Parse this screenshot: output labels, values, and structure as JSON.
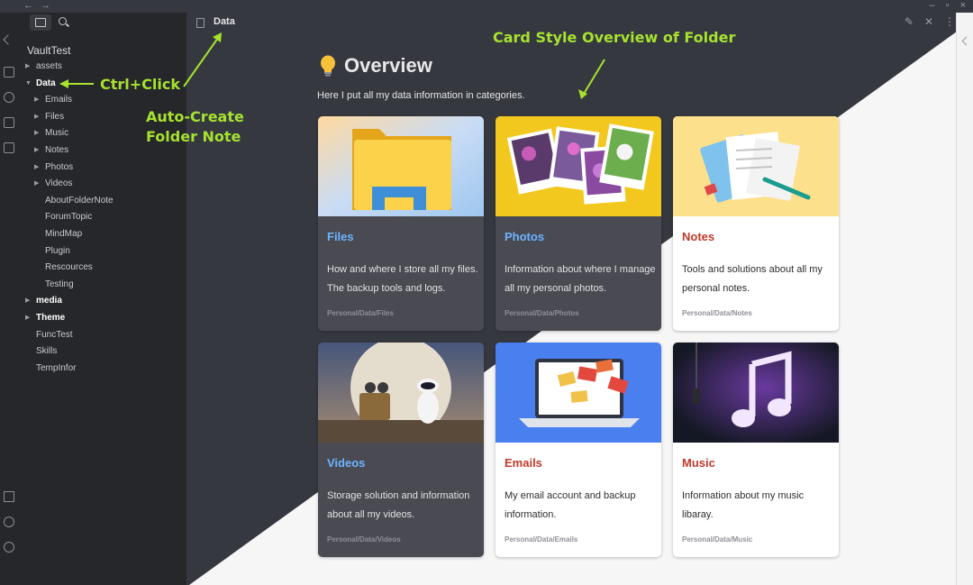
{
  "editor": {
    "doc_title": "Data"
  },
  "sidebar": {
    "vault": "VaultTest",
    "tree": [
      {
        "label": "assets",
        "level": 0,
        "arrow": "right",
        "bold": false
      },
      {
        "label": "Data",
        "level": 0,
        "arrow": "down",
        "bold": true
      },
      {
        "label": "Emails",
        "level": 1,
        "arrow": "right",
        "bold": false
      },
      {
        "label": "Files",
        "level": 1,
        "arrow": "right",
        "bold": false
      },
      {
        "label": "Music",
        "level": 1,
        "arrow": "right",
        "bold": false
      },
      {
        "label": "Notes",
        "level": 1,
        "arrow": "right",
        "bold": false
      },
      {
        "label": "Photos",
        "level": 1,
        "arrow": "right",
        "bold": false
      },
      {
        "label": "Videos",
        "level": 1,
        "arrow": "right",
        "bold": false
      },
      {
        "label": "AboutFolderNote",
        "level": 1,
        "arrow": "",
        "bold": false
      },
      {
        "label": "ForumTopic",
        "level": 1,
        "arrow": "",
        "bold": false
      },
      {
        "label": "MindMap",
        "level": 1,
        "arrow": "",
        "bold": false
      },
      {
        "label": "Plugin",
        "level": 1,
        "arrow": "",
        "bold": false
      },
      {
        "label": "Rescources",
        "level": 1,
        "arrow": "",
        "bold": false
      },
      {
        "label": "Testing",
        "level": 1,
        "arrow": "",
        "bold": false
      },
      {
        "label": "media",
        "level": 0,
        "arrow": "right",
        "bold": true
      },
      {
        "label": "Theme",
        "level": 0,
        "arrow": "right",
        "bold": true
      },
      {
        "label": "FuncTest",
        "level": 0,
        "arrow": "",
        "bold": false
      },
      {
        "label": "Skills",
        "level": 0,
        "arrow": "",
        "bold": false
      },
      {
        "label": "TempInfor",
        "level": 0,
        "arrow": "",
        "bold": false
      }
    ]
  },
  "content": {
    "title": "Overview",
    "intro": "Here I put all my data information in categories.",
    "cards": [
      {
        "title": "Files",
        "desc": "How and where I store all my files. The backup tools and logs.",
        "path": "Personal/Data/Files",
        "image": "folder-image"
      },
      {
        "title": "Photos",
        "desc": "Information about where I manage all my personal photos.",
        "path": "Personal/Data/Photos",
        "image": "photos-image"
      },
      {
        "title": "Notes",
        "desc": "Tools and solutions about all my personal notes.",
        "path": "Personal/Data/Notes",
        "image": "notes-image"
      },
      {
        "title": "Videos",
        "desc": "Storage solution and information about all my videos.",
        "path": "Personal/Data/Videos",
        "image": "movie-still-image"
      },
      {
        "title": "Emails",
        "desc": "My email account and backup information.",
        "path": "Personal/Data/Emails",
        "image": "laptop-mail-image"
      },
      {
        "title": "Music",
        "desc": "Information about my music libaray.",
        "path": "Personal/Data/Music",
        "image": "music-note-image"
      }
    ]
  },
  "annotations": {
    "ctrl_click": "Ctrl+Click",
    "auto_create_1": "Auto-Create",
    "auto_create_2": "Folder Note",
    "card_style": "Card Style Overview of Folder"
  },
  "colors": {
    "dark_bg": "#363840",
    "sidebar_bg": "#26272b",
    "light_bg": "#f6f6f7",
    "annotation": "#a6e22e",
    "dark_card_title": "#6cb4ff",
    "light_card_title": "#c0392b"
  }
}
